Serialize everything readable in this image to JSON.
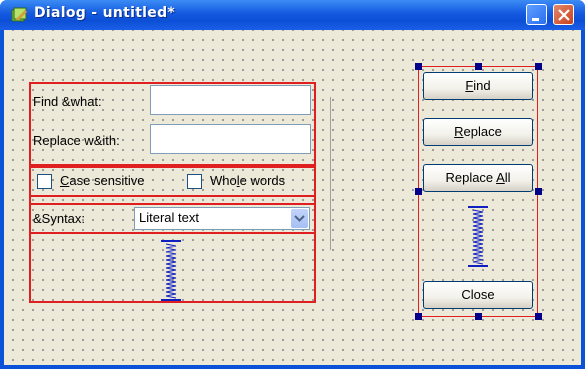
{
  "window": {
    "title": "Dialog - untitled*"
  },
  "find_label": "Find &what:",
  "replace_label": "Replace w&ith:",
  "find_value": "",
  "replace_value": "",
  "case_sensitive": {
    "prefix": "",
    "mnemonic": "C",
    "rest": "ase sensitive"
  },
  "whole_words": {
    "prefix": "Who",
    "mnemonic": "l",
    "rest": "e words"
  },
  "syntax_label": "&Syntax:",
  "syntax_value": "Literal text",
  "buttons": {
    "find": {
      "prefix": "",
      "mnemonic": "F",
      "rest": "ind"
    },
    "replace": {
      "prefix": "",
      "mnemonic": "R",
      "rest": "eplace"
    },
    "replace_all": {
      "prefix": "Replace ",
      "mnemonic": "A",
      "rest": "ll"
    },
    "close": {
      "prefix": "Close",
      "mnemonic": "",
      "rest": ""
    }
  },
  "colors": {
    "layout_box": "#e02020",
    "selection_handle": "#00008b",
    "titlebar": "#0c4fd6"
  },
  "icons": [
    "app-icon",
    "minimize-icon",
    "close-icon",
    "chevron-down-icon",
    "vertical-spacer-icon"
  ]
}
